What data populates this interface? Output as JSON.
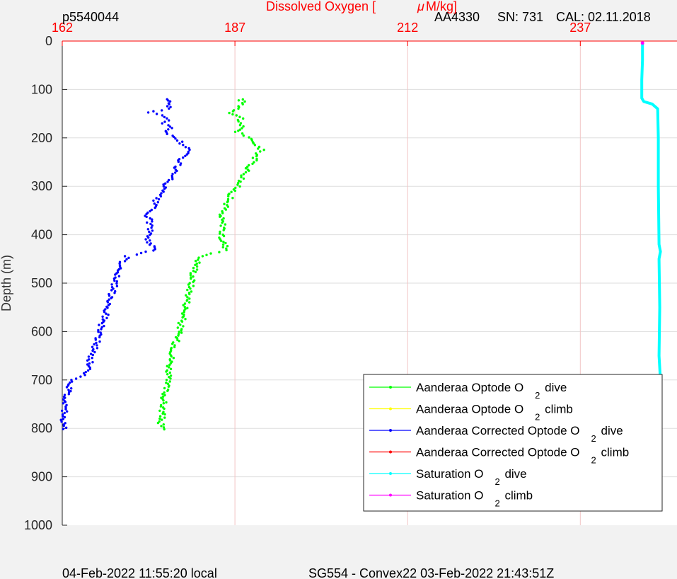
{
  "header": {
    "left_id": "p5540044",
    "instrument": "AA4330",
    "serial": "SN: 731",
    "calibration": "CAL: 02.11.2018"
  },
  "footer": {
    "local_time": "04-Feb-2022 11:55:20 local",
    "mission": "SG554 - Convex22 03-Feb-2022 21:43:51Z"
  },
  "chart_data": {
    "type": "scatter",
    "title": "",
    "xlabel": "Dissolved Oxygen [ μM/kg]",
    "xlabel_parts": {
      "prefix": "Dissolved Oxygen [",
      "mu": "μ",
      "suffix": "M/kg]"
    },
    "ylabel": "Depth (m)",
    "xlim": [
      162,
      251
    ],
    "ylim": [
      1000,
      0
    ],
    "y_reversed": true,
    "x_axis_position": "top",
    "x_ticks": [
      "162",
      "187",
      "212",
      "237"
    ],
    "y_ticks": [
      "0",
      "100",
      "200",
      "300",
      "400",
      "500",
      "600",
      "700",
      "800",
      "900",
      "1000"
    ],
    "grid": true,
    "legend_position": "lower-right",
    "colors": {
      "x_axis": "#ff0000",
      "gridline_x": "#f2c4c4",
      "gridline_y": "#dedede",
      "background": "#ffffff",
      "figure": "#f2f2f2"
    },
    "series": [
      {
        "name": "Aanderaa Optode O 2 dive",
        "legend_parts": [
          "Aanderaa Optode O",
          "2",
          "dive"
        ],
        "color": "#00ff00",
        "points": [
          [
            187.8,
            120
          ],
          [
            188.2,
            128
          ],
          [
            187.5,
            140
          ],
          [
            186.6,
            148
          ],
          [
            188.0,
            160
          ],
          [
            187.4,
            170
          ],
          [
            188.1,
            180
          ],
          [
            187.3,
            188
          ],
          [
            188.5,
            195
          ],
          [
            189.3,
            205
          ],
          [
            190.2,
            215
          ],
          [
            190.8,
            225
          ],
          [
            190.1,
            238
          ],
          [
            189.6,
            250
          ],
          [
            189.0,
            262
          ],
          [
            188.5,
            275
          ],
          [
            187.9,
            288
          ],
          [
            187.3,
            300
          ],
          [
            186.6,
            315
          ],
          [
            186.0,
            330
          ],
          [
            185.6,
            345
          ],
          [
            184.8,
            358
          ],
          [
            185.1,
            372
          ],
          [
            185.5,
            385
          ],
          [
            184.9,
            400
          ],
          [
            185.3,
            415
          ],
          [
            185.9,
            432
          ],
          [
            182.0,
            445
          ],
          [
            181.5,
            460
          ],
          [
            181.0,
            480
          ],
          [
            180.7,
            500
          ],
          [
            180.4,
            520
          ],
          [
            180.1,
            540
          ],
          [
            179.7,
            560
          ],
          [
            179.3,
            580
          ],
          [
            178.9,
            600
          ],
          [
            178.5,
            620
          ],
          [
            178.1,
            640
          ],
          [
            177.7,
            660
          ],
          [
            177.5,
            680
          ],
          [
            177.2,
            700
          ],
          [
            177.0,
            720
          ],
          [
            176.7,
            740
          ],
          [
            176.5,
            760
          ],
          [
            176.4,
            780
          ],
          [
            176.2,
            795
          ],
          [
            176.6,
            805
          ]
        ]
      },
      {
        "name": "Aanderaa Optode O 2 climb",
        "legend_parts": [
          "Aanderaa Optode O",
          "2",
          "climb"
        ],
        "color": "#ffff00",
        "points": []
      },
      {
        "name": "Aanderaa Corrected Optode O 2 dive",
        "legend_parts": [
          "Aanderaa Corrected Optode O",
          "2",
          "dive"
        ],
        "color": "#0000ff",
        "points": [
          [
            177.3,
            120
          ],
          [
            177.7,
            128
          ],
          [
            177.1,
            140
          ],
          [
            174.8,
            148
          ],
          [
            177.5,
            160
          ],
          [
            176.9,
            170
          ],
          [
            177.6,
            180
          ],
          [
            176.8,
            188
          ],
          [
            178.0,
            195
          ],
          [
            178.8,
            205
          ],
          [
            179.7,
            215
          ],
          [
            180.3,
            225
          ],
          [
            179.6,
            238
          ],
          [
            179.1,
            250
          ],
          [
            178.5,
            262
          ],
          [
            178.0,
            275
          ],
          [
            177.4,
            288
          ],
          [
            176.8,
            300
          ],
          [
            176.1,
            315
          ],
          [
            175.5,
            330
          ],
          [
            175.1,
            345
          ],
          [
            174.3,
            358
          ],
          [
            174.6,
            372
          ],
          [
            174.9,
            385
          ],
          [
            174.3,
            400
          ],
          [
            174.7,
            415
          ],
          [
            175.3,
            432
          ],
          [
            171.5,
            445
          ],
          [
            170.6,
            460
          ],
          [
            170.0,
            480
          ],
          [
            169.6,
            500
          ],
          [
            169.2,
            520
          ],
          [
            168.9,
            540
          ],
          [
            168.4,
            560
          ],
          [
            167.9,
            580
          ],
          [
            167.4,
            600
          ],
          [
            167.0,
            620
          ],
          [
            166.5,
            640
          ],
          [
            166.0,
            660
          ],
          [
            165.7,
            680
          ],
          [
            165.3,
            690
          ],
          [
            163.2,
            700
          ],
          [
            162.9,
            720
          ],
          [
            162.6,
            740
          ],
          [
            162.4,
            760
          ],
          [
            162.3,
            780
          ],
          [
            162.1,
            795
          ],
          [
            162.5,
            805
          ]
        ]
      },
      {
        "name": "Aanderaa Corrected Optode O 2 climb",
        "legend_parts": [
          "Aanderaa Corrected Optode O",
          "2",
          "climb"
        ],
        "color": "#ff0000",
        "points": []
      },
      {
        "name": "Saturation O 2 dive",
        "legend_parts": [
          "Saturation O",
          "2",
          "dive"
        ],
        "color": "#00ffff",
        "points": [
          [
            246.0,
            5
          ],
          [
            246.0,
            40
          ],
          [
            245.9,
            80
          ],
          [
            245.9,
            118
          ],
          [
            246.2,
            125
          ],
          [
            247.4,
            130
          ],
          [
            248.2,
            140
          ],
          [
            248.3,
            200
          ],
          [
            248.3,
            300
          ],
          [
            248.4,
            420
          ],
          [
            248.6,
            435
          ],
          [
            248.4,
            450
          ],
          [
            248.5,
            550
          ],
          [
            248.4,
            650
          ],
          [
            248.6,
            700
          ],
          [
            248.6,
            810
          ]
        ]
      },
      {
        "name": "Saturation O 2 climb",
        "legend_parts": [
          "Saturation O",
          "2",
          "climb"
        ],
        "color": "#ff00ff",
        "points": [
          [
            246.0,
            4
          ]
        ]
      }
    ]
  }
}
